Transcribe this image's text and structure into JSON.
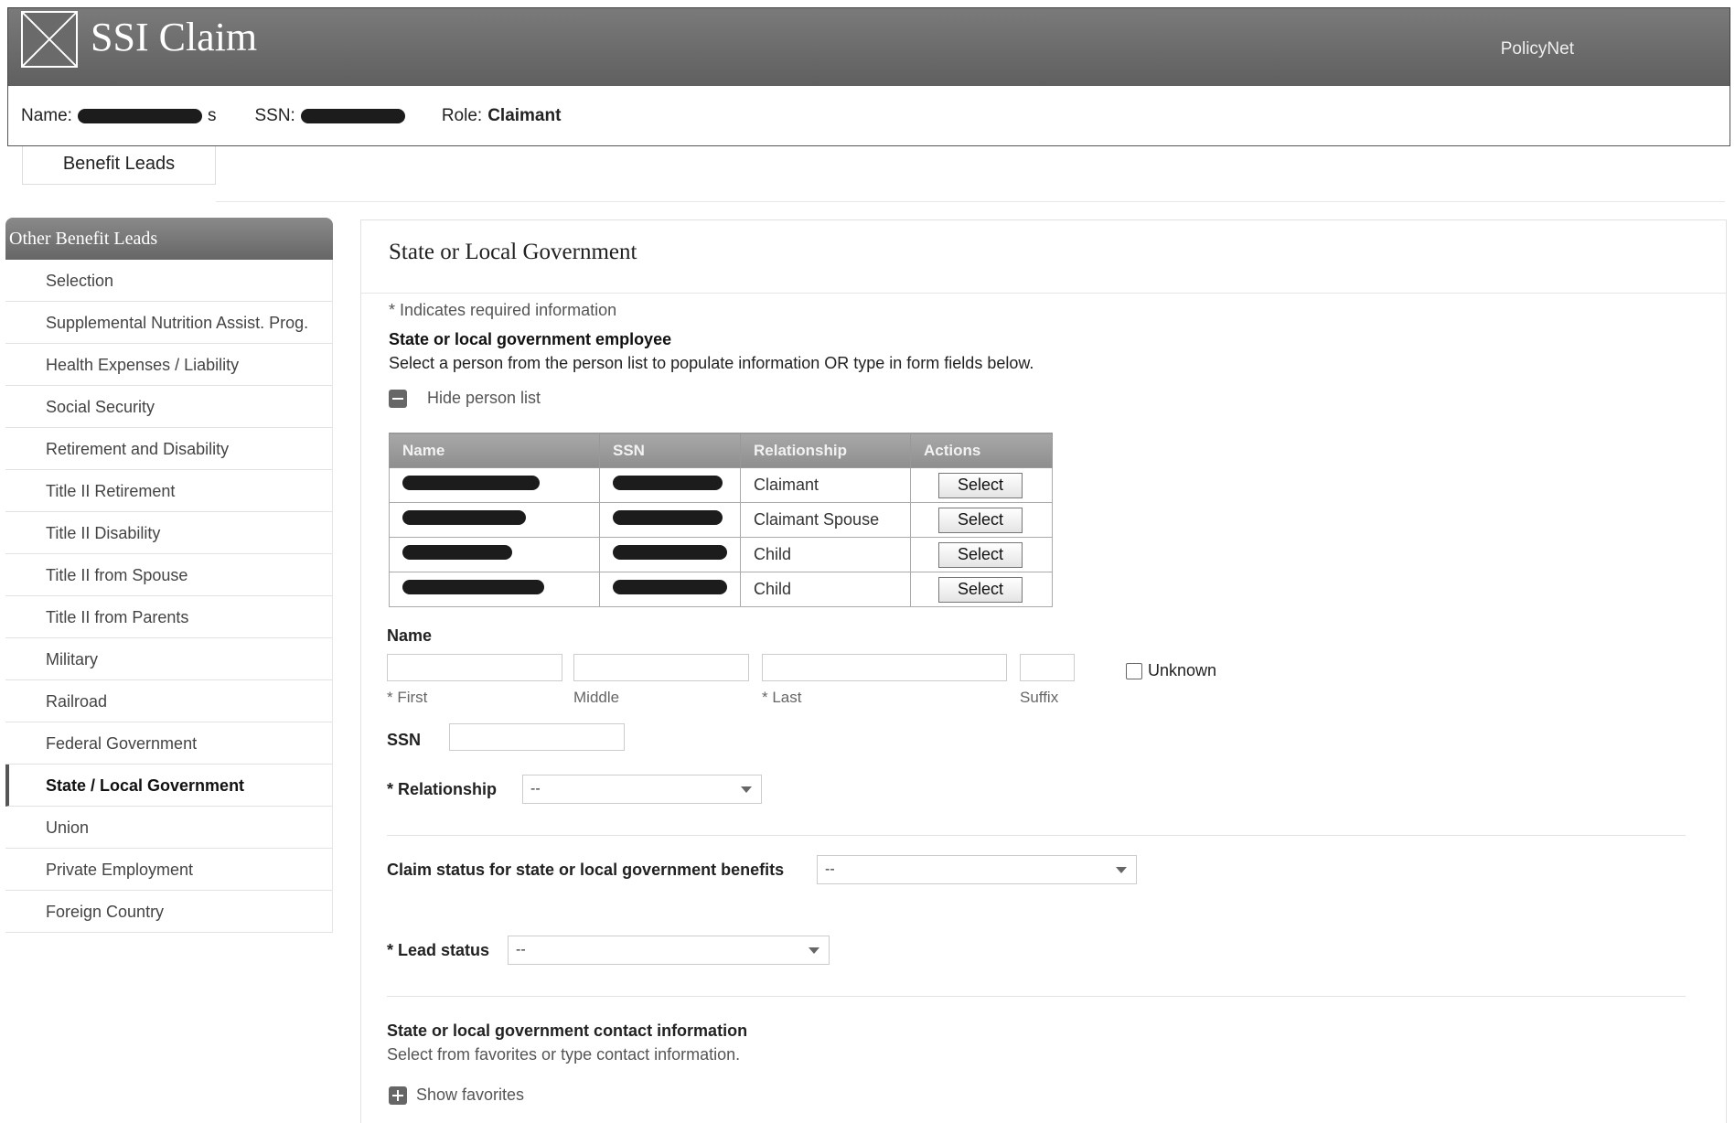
{
  "header": {
    "app_title": "SSI Claim",
    "right_link": "PolicyNet"
  },
  "userbar": {
    "name_label": "Name:",
    "name_tail": "s",
    "ssn_label": "SSN:",
    "role_label": "Role:",
    "role_value": "Claimant"
  },
  "tabs": [
    {
      "label": "Benefit Leads"
    }
  ],
  "sidebar": {
    "heading": "Other Benefit Leads",
    "items": [
      {
        "label": "Selection"
      },
      {
        "label": "Supplemental Nutrition Assist. Prog."
      },
      {
        "label": "Health Expenses / Liability"
      },
      {
        "label": "Social Security"
      },
      {
        "label": "Retirement and Disability"
      },
      {
        "label": "Title II Retirement"
      },
      {
        "label": "Title II Disability"
      },
      {
        "label": "Title II from Spouse"
      },
      {
        "label": "Title II from Parents"
      },
      {
        "label": "Military"
      },
      {
        "label": "Railroad"
      },
      {
        "label": "Federal Government"
      },
      {
        "label": "State / Local Government",
        "active": true
      },
      {
        "label": "Union"
      },
      {
        "label": "Private Employment"
      },
      {
        "label": "Foreign Country"
      }
    ]
  },
  "main": {
    "title": "State or Local Government",
    "required_note": "* Indicates required information",
    "section_title": "State or local government employee",
    "section_desc": "Select a person from the person list to populate information OR type in form fields below.",
    "hide_person_list": "Hide person list",
    "table": {
      "columns": [
        "Name",
        "SSN",
        "Relationship",
        "Actions"
      ],
      "rows": [
        {
          "relationship": "Claimant",
          "action": "Select"
        },
        {
          "relationship": "Claimant Spouse",
          "action": "Select"
        },
        {
          "relationship": "Child",
          "action": "Select"
        },
        {
          "relationship": "Child",
          "action": "Select"
        }
      ]
    },
    "name_label": "Name",
    "first_label": "* First",
    "middle_label": "Middle",
    "last_label": "* Last",
    "suffix_label": "Suffix",
    "unknown_label": "Unknown",
    "ssn_label": "SSN",
    "relationship_label": "* Relationship",
    "relationship_value": "--",
    "claim_status_label": "Claim status for state or local government benefits",
    "claim_status_value": "--",
    "lead_status_label": "* Lead status",
    "lead_status_value": "--",
    "contact_title": "State or local government contact information",
    "contact_desc": "Select from favorites or type contact information.",
    "show_favorites": "Show favorites"
  }
}
